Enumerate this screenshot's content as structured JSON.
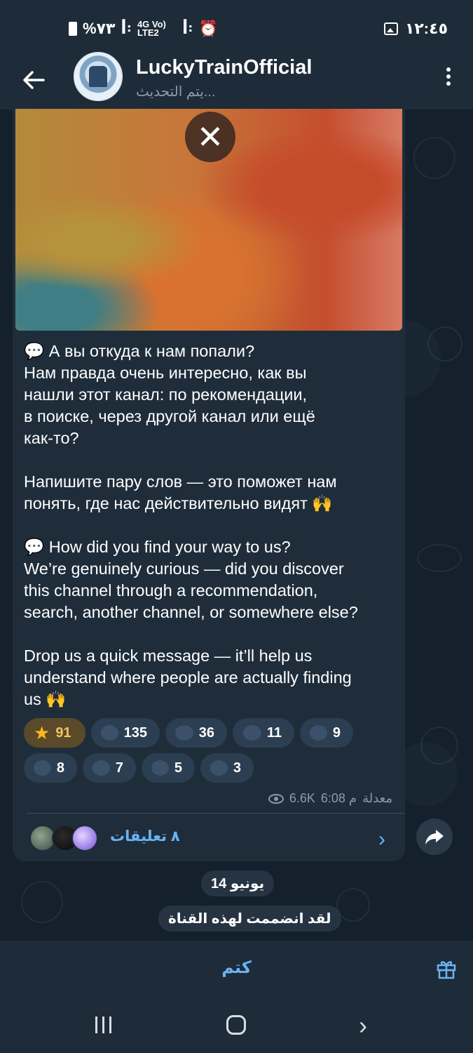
{
  "status_bar": {
    "left": "%٧٣ ꟾ ꞉ 4G LTE2 ꟾ ⏰",
    "battery_text": "%٧٣",
    "network_text": "4G Vo) LTE2",
    "time": "١٢:٤٥"
  },
  "header": {
    "title": "LuckyTrainOfficial",
    "subtitle": "يتم التحديث..."
  },
  "message": {
    "text_ru": "💬 А вы откуда к нам попали?\nНам правда очень интересно, как вы\nнашли этот канал: по рекомендации,\nв поиске, через другой канал или ещё\nкак-то?\n\nНапишите пару слов — это поможет нам\nпонять, где нас действительно видят 🙌\n\n💬 How did you find your way to us?\nWe’re genuinely curious — did you discover\nthis channel through a recommendation,\nsearch, another channel, or somewhere else?\n\nDrop us a quick message — it’ll help us\nunderstand where people are actually finding\nus 🙌",
    "reactions": [
      {
        "emoji": "⭐",
        "count": "91"
      },
      {
        "emoji": "heart",
        "count": "135"
      },
      {
        "emoji": "thumbs-up",
        "count": "36"
      },
      {
        "emoji": "fire",
        "count": "11"
      },
      {
        "emoji": "rocket",
        "count": "9"
      },
      {
        "emoji": "unicorn",
        "count": "8"
      },
      {
        "emoji": "party",
        "count": "7"
      },
      {
        "emoji": "trophy",
        "count": "5"
      },
      {
        "emoji": "monkey",
        "count": "3"
      }
    ],
    "edited": "معدلة",
    "time": "6:08 م",
    "views": "6.6K",
    "comments_label": "٨ تعليقات"
  },
  "service": {
    "date": "14 يونيو",
    "joined": "لقد انضممت لهذه القناة"
  },
  "bottom_bar": {
    "mute_label": "كتم"
  },
  "colors": {
    "accent": "#6ab3f3",
    "bubble": "#1f2d3b",
    "header": "#1e2b38",
    "star_reaction": "#f3c65a"
  }
}
